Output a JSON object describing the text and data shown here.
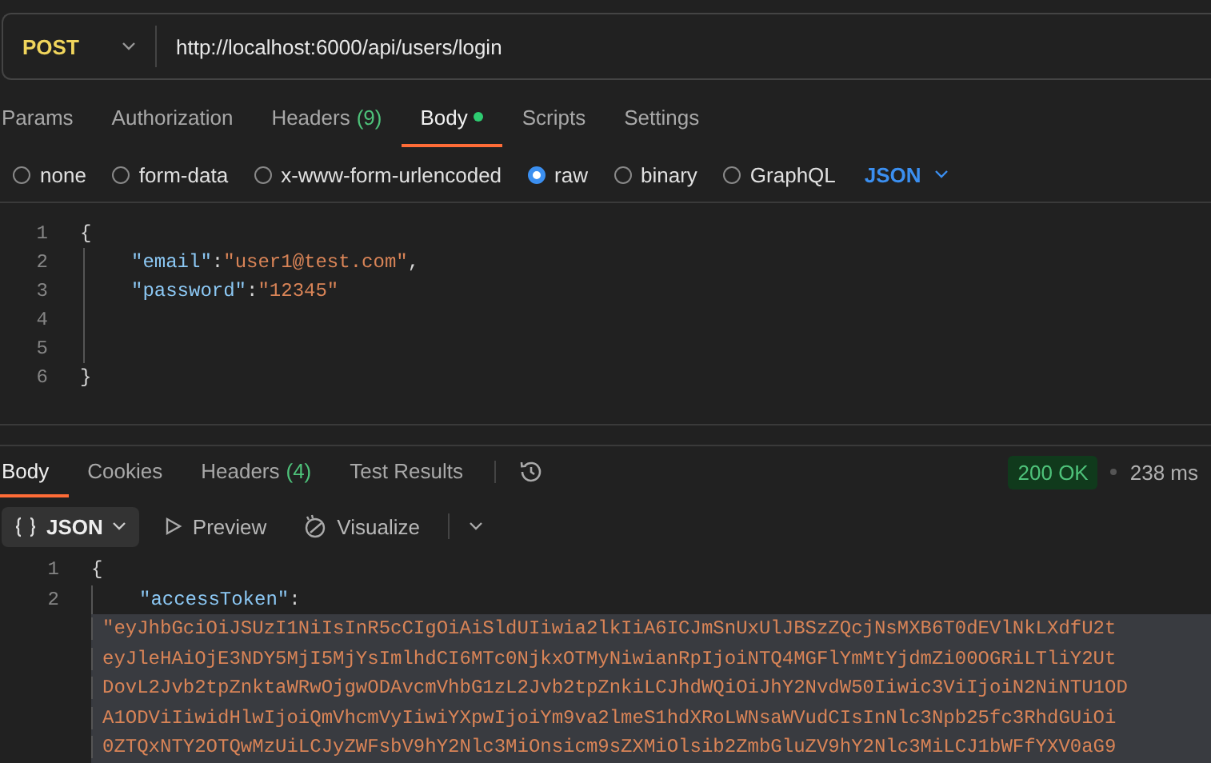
{
  "request": {
    "method": "POST",
    "url": "http://localhost:6000/api/users/login",
    "tabs": [
      {
        "label": "Params",
        "selected": false
      },
      {
        "label": "Authorization",
        "selected": false
      },
      {
        "label": "Headers",
        "count": "(9)",
        "selected": false
      },
      {
        "label": "Body",
        "dot": true,
        "selected": true
      },
      {
        "label": "Scripts",
        "selected": false
      },
      {
        "label": "Settings",
        "selected": false
      }
    ],
    "body_types": [
      {
        "label": "none",
        "selected": false
      },
      {
        "label": "form-data",
        "selected": false
      },
      {
        "label": "x-www-form-urlencoded",
        "selected": false
      },
      {
        "label": "raw",
        "selected": true
      },
      {
        "label": "binary",
        "selected": false
      },
      {
        "label": "GraphQL",
        "selected": false
      }
    ],
    "format": "JSON",
    "lines": [
      {
        "number": "1",
        "tokens": [
          {
            "kind": "punct",
            "text": "{"
          }
        ]
      },
      {
        "number": "2",
        "tokens": [
          {
            "kind": "key",
            "text": "\"email\""
          },
          {
            "kind": "punct",
            "text": ":"
          },
          {
            "kind": "string",
            "text": "\"user1@test.com\""
          },
          {
            "kind": "punct",
            "text": ","
          }
        ]
      },
      {
        "number": "3",
        "tokens": [
          {
            "kind": "key",
            "text": "\"password\""
          },
          {
            "kind": "punct",
            "text": ":"
          },
          {
            "kind": "string",
            "text": "\"12345\""
          }
        ]
      },
      {
        "number": "4"
      },
      {
        "number": "5"
      },
      {
        "number": "6",
        "tokens": [
          {
            "kind": "punct",
            "text": "}"
          }
        ]
      }
    ]
  },
  "response": {
    "tabs": [
      {
        "label": "Body",
        "selected": true
      },
      {
        "label": "Cookies",
        "selected": false
      },
      {
        "label": "Headers",
        "count": "(4)",
        "selected": false
      },
      {
        "label": "Test Results",
        "selected": false
      }
    ],
    "status": "200 OK",
    "time": "238 ms",
    "view_format": "JSON",
    "view_buttons": [
      "Preview",
      "Visualize"
    ],
    "lines": [
      {
        "number": "1",
        "selected": false,
        "tokens": [
          {
            "kind": "punct",
            "text": "{"
          }
        ]
      },
      {
        "number": "2",
        "selected": false,
        "tokens": [
          {
            "kind": "key",
            "text": "\"accessToken\""
          },
          {
            "kind": "punct",
            "text": ":"
          }
        ]
      },
      {
        "selected": true,
        "tokens": [
          {
            "kind": "string",
            "text": "\"eyJhbGciOiJSUzI1NiIsInR5cCIgOiAiSldUIiwia2lkIiA6ICJmSnUxUlJBSzZQcjNsMXB6T0dEVlNkLXdfU2t"
          }
        ]
      },
      {
        "selected": true,
        "tokens": [
          {
            "kind": "string",
            "text": "eyJleHAiOjE3NDY5MjI5MjYsImlhdCI6MTc0NjkxOTMyNiwianRpIjoiNTQ4MGFlYmMtYjdmZi00OGRiLTliY2Ut"
          }
        ]
      },
      {
        "selected": true,
        "tokens": [
          {
            "kind": "string",
            "text": "DovL2Jvb2tpZnktaWRwOjgwODAvcmVhbG1zL2Jvb2tpZnkiLCJhdWQiOiJhY2NvdW50Iiwic3ViIjoiN2NiNTU1OD"
          }
        ]
      },
      {
        "selected": true,
        "tokens": [
          {
            "kind": "string",
            "text": "A1ODViIiwidHlwIjoiQmVhcmVyIiwiYXpwIjoiYm9va2lmeS1hdXRoLWNsaWVudCIsInNlc3Npb25fc3RhdGUiOi"
          }
        ]
      },
      {
        "selected": true,
        "tokens": [
          {
            "kind": "string",
            "text": "0ZTQxNTY2OTQwMzUiLCJyZWFsbV9hY2Nlc3MiOnsicm9sZXMiOlsib2ZmbGluZV9hY2Nlc3MiLCJ1bWFfYXV0aG9"
          }
        ]
      }
    ]
  }
}
